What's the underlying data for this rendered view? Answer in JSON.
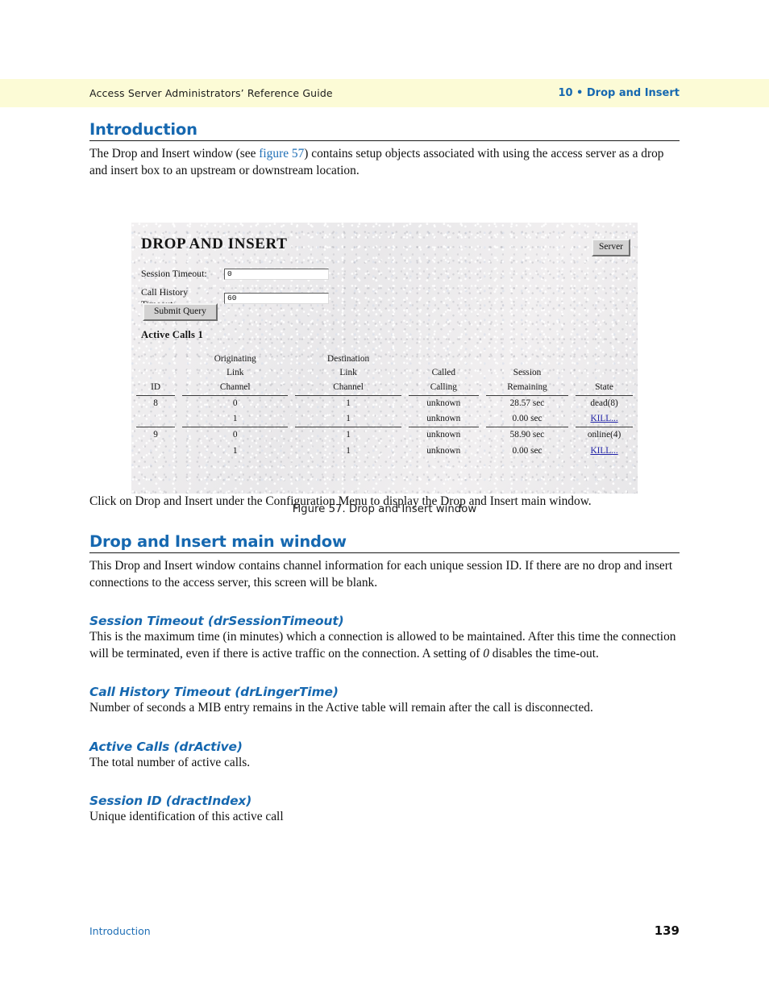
{
  "header": {
    "left_title": "Access Server Administrators’ Reference Guide",
    "right_title": "10 • Drop and Insert"
  },
  "sections": {
    "introduction": {
      "heading": "Introduction",
      "paragraph_before_link": "The Drop and Insert window (see ",
      "link_text": "figure 57",
      "paragraph_after_link": ") contains setup objects associated with using the access server as a drop and insert box to an upstream or downstream location."
    },
    "after_figure": {
      "text_part_1": "Click on ",
      "text_part_2": "Drop and Insert",
      "text_part_3": " under the ",
      "text_part_4": "Configuration Menu",
      "text_part_5": " to display the Drop and Insert main window."
    },
    "main_window": {
      "heading": "Drop and Insert main window",
      "paragraph": "This Drop and Insert window contains channel information for each unique session ID. If there are no drop and insert connections to the access server, this screen will be blank."
    },
    "session_timeout": {
      "heading": "Session Timeout (drSessionTimeout)",
      "para_1": "This is the maximum time (in minutes) which a connection is allowed to be maintained. After this time the connection will be terminated, even if there is active traffic on the connection. A setting of ",
      "para_italic": "0",
      "para_2": " disables the time-out."
    },
    "call_history_timeout": {
      "heading": "Call History Timeout (drLingerTime)",
      "paragraph": "Number of seconds a MIB entry remains in the Active table will remain after the call is disconnected."
    },
    "active_calls": {
      "heading": "Active Calls (drActive)",
      "paragraph": "The total number of active calls."
    },
    "session_id": {
      "heading": "Session ID (dractIndex)",
      "paragraph": "Unique identification of this active call"
    }
  },
  "figure": {
    "caption": "Figure 57. Drop and Insert window",
    "screenshot": {
      "title": "DROP AND INSERT",
      "server_button": "Server",
      "fields": [
        {
          "label": "Session Timeout:",
          "value": "0"
        },
        {
          "label": "Call History Timeout:",
          "value": "60"
        }
      ],
      "submit_button": "Submit Query",
      "active_calls_label": "Active Calls 1",
      "table": {
        "headers": {
          "id": "ID",
          "originating_top": "Originating",
          "originating_mid": "Link",
          "originating_bot": "Channel",
          "destination_top": "Destination",
          "destination_mid": "Link",
          "destination_bot": "Channel",
          "called_mid": "Called",
          "called_bot": "Calling",
          "session_mid": "Session",
          "session_bot": "Remaining",
          "state": "State"
        },
        "rows": [
          {
            "id": "8",
            "line1": {
              "orig": "0",
              "dest": "1",
              "called": "unknown",
              "session": "28.57 sec",
              "state": "dead(8)"
            },
            "line2": {
              "orig": "1",
              "dest": "1",
              "called": "unknown",
              "session": "0.00 sec",
              "state": "KILL..."
            }
          },
          {
            "id": "9",
            "line1": {
              "orig": "0",
              "dest": "1",
              "called": "unknown",
              "session": "58.90 sec",
              "state": "online(4)"
            },
            "line2": {
              "orig": "1",
              "dest": "1",
              "called": "unknown",
              "session": "0.00 sec",
              "state": "KILL..."
            }
          }
        ]
      }
    }
  },
  "footer": {
    "left": "Introduction",
    "page_number": "139"
  },
  "colors": {
    "heading_blue": "#1668b0",
    "link_blue": "#1f6fb6",
    "header_band": "#fcfbd6",
    "kill_link": "#2224a8"
  }
}
